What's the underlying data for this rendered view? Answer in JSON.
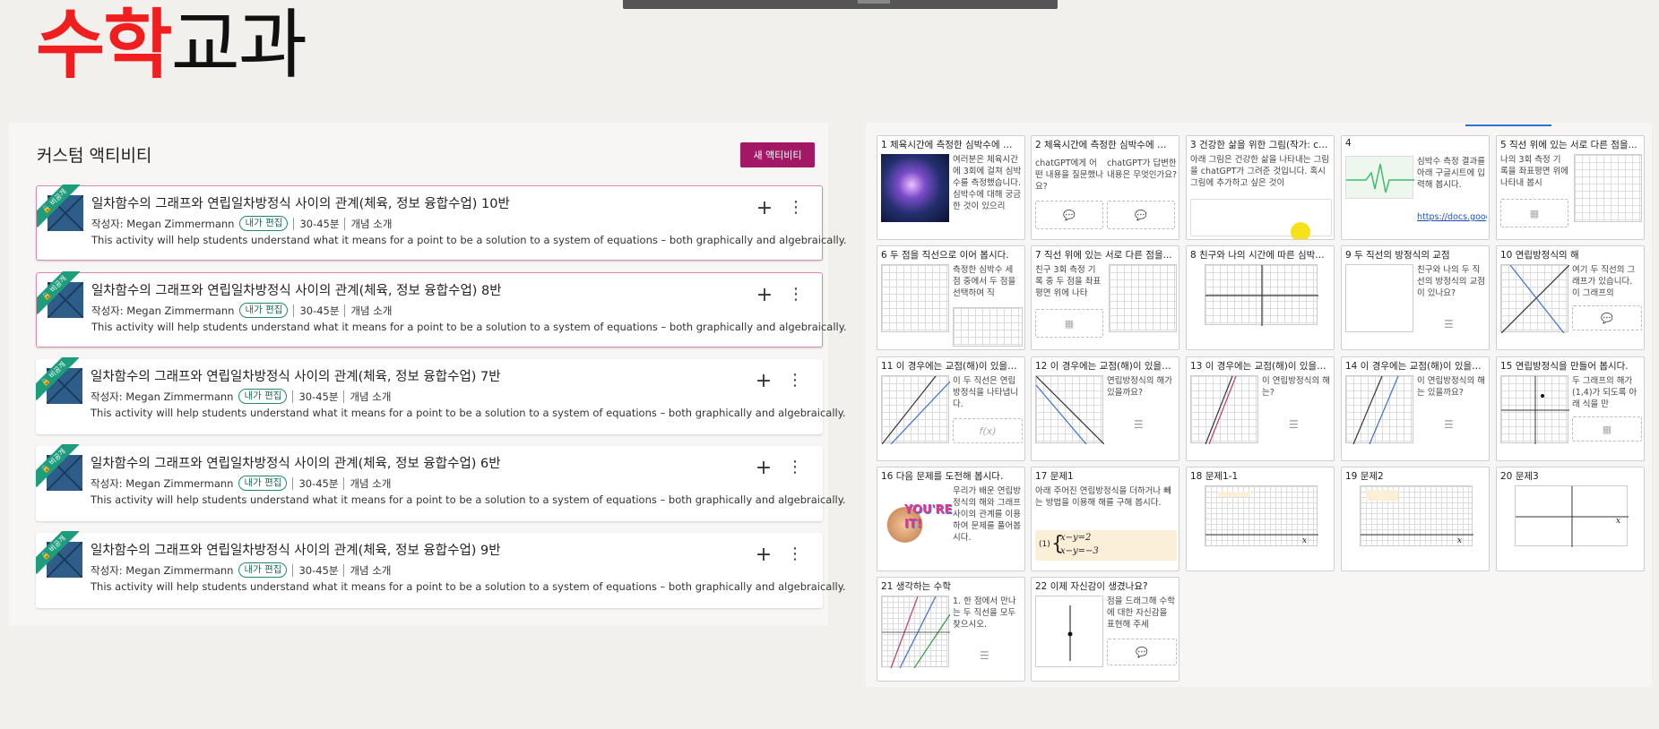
{
  "page_title": {
    "part1": "수학",
    "part2": "교과"
  },
  "left_panel": {
    "title": "커스텀 액티비티",
    "new_button": "새 액티비티",
    "ribbon_label": "🔒 비공개",
    "activities": [
      {
        "title": "일차함수의 그래프와 연립일차방정식 사이의 관계(체육, 정보 융합수업) 10반",
        "author": "작성자: Megan Zimmermann",
        "badge": "내가 편집",
        "duration": "30-45분",
        "type": "개념 소개",
        "description": "This activity will help students understand what it means for a point to be a solution to a system of equations – both graphically and algebraically."
      },
      {
        "title": "일차함수의 그래프와 연립일차방정식 사이의 관계(체육, 정보 융합수업) 8반",
        "author": "작성자: Megan Zimmermann",
        "badge": "내가 편집",
        "duration": "30-45분",
        "type": "개념 소개",
        "description": "This activity will help students understand what it means for a point to be a solution to a system of equations – both graphically and algebraically."
      },
      {
        "title": "일차함수의 그래프와 연립일차방정식 사이의 관계(체육, 정보 융합수업) 7반",
        "author": "작성자: Megan Zimmermann",
        "badge": "내가 편집",
        "duration": "30-45분",
        "type": "개념 소개",
        "description": "This activity will help students understand what it means for a point to be a solution to a system of equations – both graphically and algebraically."
      },
      {
        "title": "일차함수의 그래프와 연립일차방정식 사이의 관계(체육, 정보 융합수업) 6반",
        "author": "작성자: Megan Zimmermann",
        "badge": "내가 편집",
        "duration": "30-45분",
        "type": "개념 소개",
        "description": "This activity will help students understand what it means for a point to be a solution to a system of equations – both graphically and algebraically."
      },
      {
        "title": "일차함수의 그래프와 연립일차방정식 사이의 관계(체육, 정보 융합수업) 9반",
        "author": "작성자: Megan Zimmermann",
        "badge": "내가 편집",
        "duration": "30-45분",
        "type": "개념 소개",
        "description": "This activity will help students understand what it means for a point to be a solution to a system of equations – both graphically and algebraically."
      }
    ]
  },
  "slides": [
    {
      "title": "1 체육시간에 측정한 심박수에 대해...",
      "text": "여러분은 체육시간에 3회에 걸쳐 심박수를 측정했습니다. 심박수에 대해 궁금한 것이 있으리"
    },
    {
      "title": "2 체육시간에 측정한 심박수에 대해...",
      "text": "chatGPT에게 어떤 내용을 질문했나요?",
      "text2": "chatGPT가 답변한 내용은 무엇인가요?"
    },
    {
      "title": "3 건강한 삶을 위한 그림(작가: chat...",
      "text": "아래 그림은 건강한 삶을 나타내는 그림을 chatGPT가 그려준 것입니다. 혹시 그림에 추가하고 싶은 것이"
    },
    {
      "title": "4",
      "text": "심박수 측정 결과를 아래 구글시트에 입력해 봅시다.",
      "link": "https://docs.google.com/sprea"
    },
    {
      "title": "5 직선 위에 있는 서로 다른 점을...",
      "text": "나의 3회 측정 기록을 좌표평면 위에 나타내 봅시"
    },
    {
      "title": "6 두 점을 직선으로 이어 봅시다.",
      "text": "측정한 심박수 세 점 중에서 두 점을 선택하여 직"
    },
    {
      "title": "7 직선 위에 있는 서로 다른 점을...",
      "text": "친구 3회 측정 기록 중 두 점을 좌표평면 위에 나타"
    },
    {
      "title": "8 친구와 나의 시간에 따른 심박수...",
      "text": ""
    },
    {
      "title": "9 두 직선의 방정식의 교점",
      "text": "친구와 나의 두 직선의 방정식의 교점이 있나요?"
    },
    {
      "title": "10 연립방정식의 해",
      "text": "여기 두 직선의 그래프가 있습니다. 이 그래프의"
    },
    {
      "title": "11 이 경우에는 교점(해)이 있을까요?",
      "text": "이 두 직선은 연립방정식을 나타냅니다.",
      "fx": "f(x)"
    },
    {
      "title": "12 이 경우에는 교점(해)이 있을까요?",
      "text": "연립방정식의 해가 있을까요?"
    },
    {
      "title": "13 이 경우에는 교점(해)이 있을까요?",
      "text": "이 연립방정식의 해는?"
    },
    {
      "title": "14 이 경우에는 교점(해)이 있을까요?",
      "text": "이 연립방정식의 해는 있을까요?"
    },
    {
      "title": "15 연립방정식을 만들어 봅시다.",
      "text": "두 그래프의 해가 (1,4)가 되도록 아래 식을 만"
    },
    {
      "title": "16 다음 문제를 도전해 봅시다.",
      "text": "우리가 배운 연립방정식의 해와 그래프 사이의 관계를 이용하여 문제를 풀어봅시다.",
      "sticker": "YOU'RE IT!"
    },
    {
      "title": "17 문제1",
      "text": "아래 주어진 연립방정식을 더하거나 빼는 방법을 이용해 해를 구해 봅시다.",
      "eq1": "x−y=2",
      "eq2": "x−y=−3",
      "eq_label": "(1)"
    },
    {
      "title": "18 문제1-1",
      "text": ""
    },
    {
      "title": "19 문제2",
      "text": ""
    },
    {
      "title": "20 문제3",
      "text": ""
    },
    {
      "title": "21 생각하는 수학",
      "text": "1. 한 점에서 만나는 두 직선을 모두 찾으시오."
    },
    {
      "title": "22 이제 자신감이 생겼나요?",
      "text": "점을 드래그해 수학에 대한 자신감을 표현해 주세"
    }
  ],
  "axis_label_x": "x",
  "colors": {
    "accent": "#a31865",
    "ribbon": "#1e9d7c",
    "title_red": "#f01e1e"
  }
}
